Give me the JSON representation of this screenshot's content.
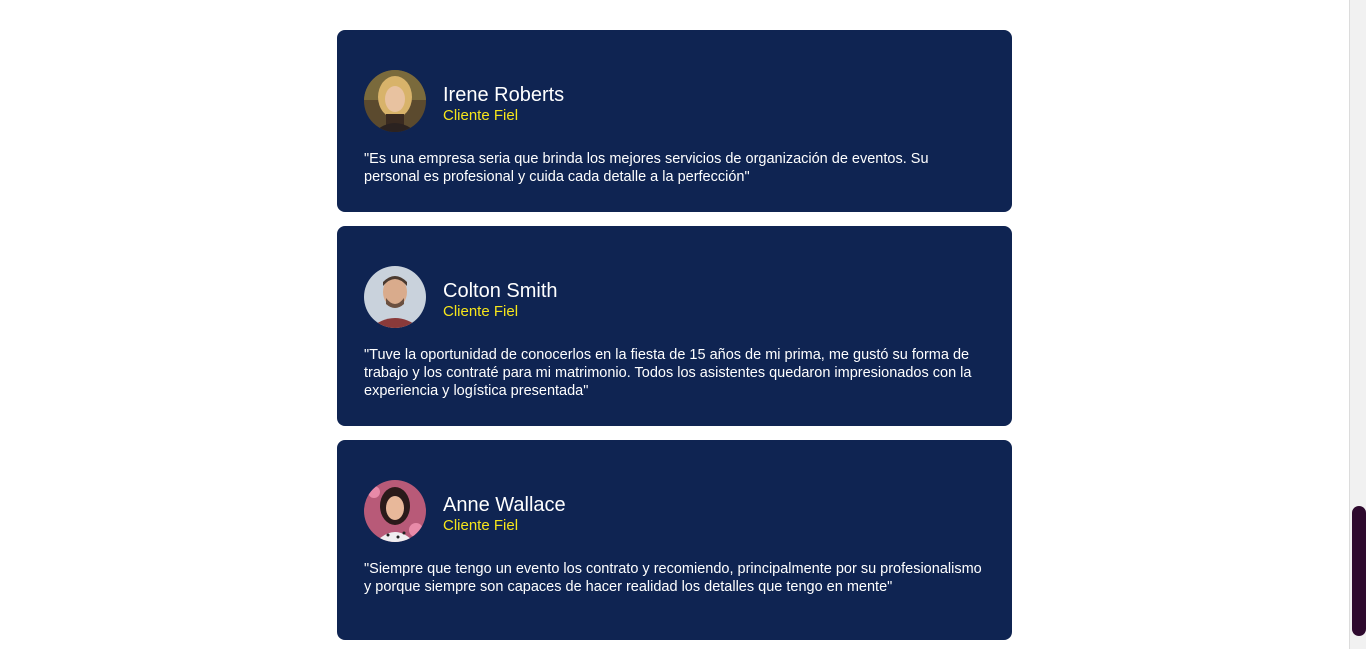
{
  "testimonials": [
    {
      "name": "Irene Roberts",
      "role": "Cliente Fiel",
      "quote": "\"Es una empresa seria que brinda los mejores servicios de organización de eventos. Su personal es profesional y cuida cada detalle a la perfección\"",
      "avatar": "woman-portrait-avatar"
    },
    {
      "name": "Colton Smith",
      "role": "Cliente Fiel",
      "quote": "\"Tuve la oportunidad de conocerlos en la fiesta de 15 años de mi prima, me gustó su forma de trabajo y los contraté para mi matrimonio. Todos los asistentes quedaron impresionados con la experiencia y logística presentada\"",
      "avatar": "man-portrait-avatar"
    },
    {
      "name": "Anne Wallace",
      "role": "Cliente Fiel",
      "quote": "\"Siempre que tengo un evento los contrato y recomiendo, principalmente por su profesionalismo y porque siempre son capaces de hacer realidad los detalles que tengo en mente\"",
      "avatar": "woman-portrait-avatar"
    }
  ],
  "colors": {
    "card_background": "#0f2452",
    "role_text": "#f5e51b",
    "name_text": "#ffffff",
    "scroll_thumb": "#2e0a2e"
  }
}
